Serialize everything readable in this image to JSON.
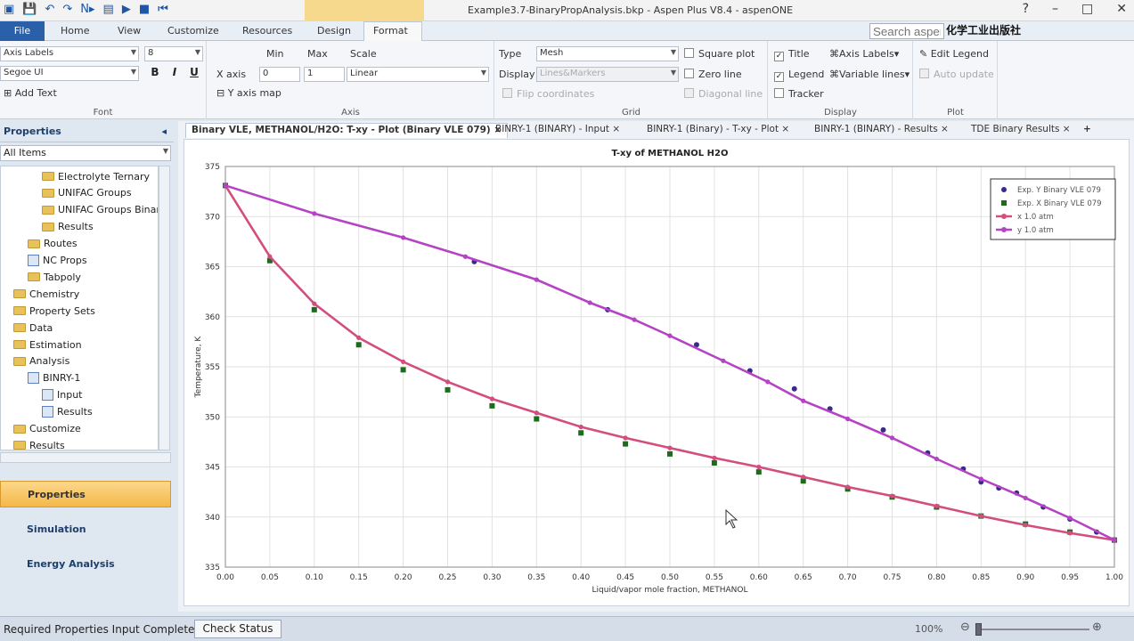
{
  "window": {
    "title": "Example3.7-BinaryPropAnalysis.bkp - Aspen Plus V8.4 - aspenONE",
    "watermark": "化学工业出版社"
  },
  "ribbon_tabs": [
    "Home",
    "View",
    "Customize",
    "Resources",
    "Design",
    "Format"
  ],
  "file_tab": "File",
  "search": {
    "placeholder": "Search aspenO"
  },
  "font_group": {
    "label": "Font",
    "style_select": "Axis Labels",
    "size_select": "8",
    "font_select": "Segoe UI",
    "bold": "B",
    "italic": "I",
    "underline": "U",
    "add_text": "Add Text"
  },
  "axis_group": {
    "label": "Axis",
    "min_header": "Min",
    "max_header": "Max",
    "scale_header": "Scale",
    "x_axis_label": "X axis",
    "x_min": "0",
    "x_max": "1",
    "x_scale": "Linear",
    "y_axis_map": "Y axis map"
  },
  "grid_group": {
    "label": "Grid",
    "type_label": "Type",
    "type_value": "Mesh",
    "display_label": "Display",
    "display_value": "Lines&Markers",
    "flip_coordinates": "Flip coordinates",
    "square_plot": "Square plot",
    "zero_line": "Zero line",
    "diagonal_line": "Diagonal line"
  },
  "display_group": {
    "label": "Display",
    "title": "Title",
    "legend": "Legend",
    "tracker": "Tracker",
    "axis_labels": "Axis Labels",
    "variable_lines": "Variable lines"
  },
  "plot_group": {
    "label": "Plot",
    "edit_legend": "Edit Legend",
    "auto_update": "Auto update"
  },
  "left_pane": {
    "header": "Properties",
    "filter": "All Items",
    "tree": [
      {
        "label": "Electrolyte Ternary",
        "indent": 2,
        "icon": "folder"
      },
      {
        "label": "UNIFAC Groups",
        "indent": 2,
        "icon": "folder"
      },
      {
        "label": "UNIFAC Groups Binary",
        "indent": 2,
        "icon": "folder"
      },
      {
        "label": "Results",
        "indent": 2,
        "icon": "folder"
      },
      {
        "label": "Routes",
        "indent": 1,
        "icon": "folder"
      },
      {
        "label": "NC Props",
        "indent": 1,
        "icon": "doc"
      },
      {
        "label": "Tabpoly",
        "indent": 1,
        "icon": "folder"
      },
      {
        "label": "Chemistry",
        "indent": 0,
        "icon": "folder"
      },
      {
        "label": "Property Sets",
        "indent": 0,
        "icon": "folder"
      },
      {
        "label": "Data",
        "indent": 0,
        "icon": "folder"
      },
      {
        "label": "Estimation",
        "indent": 0,
        "icon": "folder"
      },
      {
        "label": "Analysis",
        "indent": 0,
        "icon": "folder"
      },
      {
        "label": "BINRY-1",
        "indent": 1,
        "icon": "doc"
      },
      {
        "label": "Input",
        "indent": 2,
        "icon": "doc"
      },
      {
        "label": "Results",
        "indent": 2,
        "icon": "doc"
      },
      {
        "label": "Customize",
        "indent": 0,
        "icon": "folder"
      },
      {
        "label": "Results",
        "indent": 0,
        "icon": "folder"
      }
    ],
    "nav": [
      "Properties",
      "Simulation",
      "Energy Analysis"
    ]
  },
  "doc_tabs": [
    "Binary VLE, METHANOL/H2O: T-xy - Plot (Binary VLE 079)",
    "BINRY-1 (BINARY) - Input",
    "BINRY-1 (Binary) - T-xy - Plot",
    "BINRY-1 (BINARY) - Results",
    "TDE Binary Results"
  ],
  "status": {
    "message": "Required Properties Input Complete",
    "check_status": "Check Status",
    "zoom": "100%"
  },
  "chart_data": {
    "type": "line",
    "title": "T-xy of METHANOL H2O",
    "xlabel": "Liquid/vapor mole fraction, METHANOL",
    "ylabel": "Temperature, K",
    "xlim": [
      0,
      1
    ],
    "ylim": [
      335,
      375
    ],
    "xticks": [
      "0.00",
      "0.05",
      "0.10",
      "0.15",
      "0.20",
      "0.25",
      "0.30",
      "0.35",
      "0.40",
      "0.45",
      "0.50",
      "0.55",
      "0.60",
      "0.65",
      "0.70",
      "0.75",
      "0.80",
      "0.85",
      "0.90",
      "0.95",
      "1.00"
    ],
    "yticks": [
      "335",
      "340",
      "345",
      "350",
      "355",
      "360",
      "365",
      "370",
      "375"
    ],
    "grid": true,
    "legend_position": "top-right",
    "series": [
      {
        "name": "Exp. Y Binary VLE 079",
        "kind": "scatter",
        "marker": "circle",
        "color": "#3a2a8f",
        "x": [
          0.0,
          0.28,
          0.43,
          0.53,
          0.59,
          0.64,
          0.68,
          0.74,
          0.79,
          0.83,
          0.85,
          0.87,
          0.89,
          0.92,
          0.95,
          0.98,
          1.0
        ],
        "y": [
          373.1,
          365.5,
          360.7,
          357.2,
          354.6,
          352.8,
          350.8,
          348.7,
          346.4,
          344.8,
          343.5,
          342.9,
          342.4,
          341.0,
          339.8,
          338.5,
          337.7
        ]
      },
      {
        "name": "Exp. X Binary VLE 079",
        "kind": "scatter",
        "marker": "square",
        "color": "#1e6b1e",
        "x": [
          0.0,
          0.05,
          0.1,
          0.15,
          0.2,
          0.25,
          0.3,
          0.35,
          0.4,
          0.45,
          0.5,
          0.55,
          0.6,
          0.65,
          0.7,
          0.75,
          0.8,
          0.85,
          0.9,
          0.95,
          1.0
        ],
        "y": [
          373.1,
          365.6,
          360.7,
          357.2,
          354.7,
          352.7,
          351.1,
          349.8,
          348.4,
          347.3,
          346.3,
          345.4,
          344.5,
          343.6,
          342.8,
          342.0,
          341.0,
          340.1,
          339.3,
          338.5,
          337.7
        ]
      },
      {
        "name": "x  1.0 atm",
        "kind": "line",
        "color": "#d44d7f",
        "x": [
          0.0,
          0.05,
          0.1,
          0.15,
          0.2,
          0.25,
          0.3,
          0.35,
          0.4,
          0.45,
          0.5,
          0.55,
          0.6,
          0.65,
          0.7,
          0.75,
          0.8,
          0.85,
          0.9,
          0.95,
          1.0
        ],
        "y": [
          373.1,
          366.0,
          361.3,
          357.9,
          355.5,
          353.5,
          351.8,
          350.4,
          349.0,
          347.9,
          346.9,
          345.9,
          345.0,
          344.0,
          343.0,
          342.1,
          341.1,
          340.1,
          339.2,
          338.4,
          337.7
        ]
      },
      {
        "name": "y  1.0 atm",
        "kind": "line",
        "color": "#b444c4",
        "x": [
          0.0,
          0.1,
          0.2,
          0.27,
          0.35,
          0.41,
          0.46,
          0.5,
          0.56,
          0.61,
          0.65,
          0.7,
          0.75,
          0.8,
          0.85,
          0.9,
          0.95,
          1.0
        ],
        "y": [
          373.1,
          370.3,
          367.9,
          366.0,
          363.7,
          361.4,
          359.7,
          358.1,
          355.6,
          353.5,
          351.6,
          349.8,
          347.9,
          345.8,
          343.8,
          341.9,
          339.9,
          337.7
        ]
      }
    ]
  }
}
